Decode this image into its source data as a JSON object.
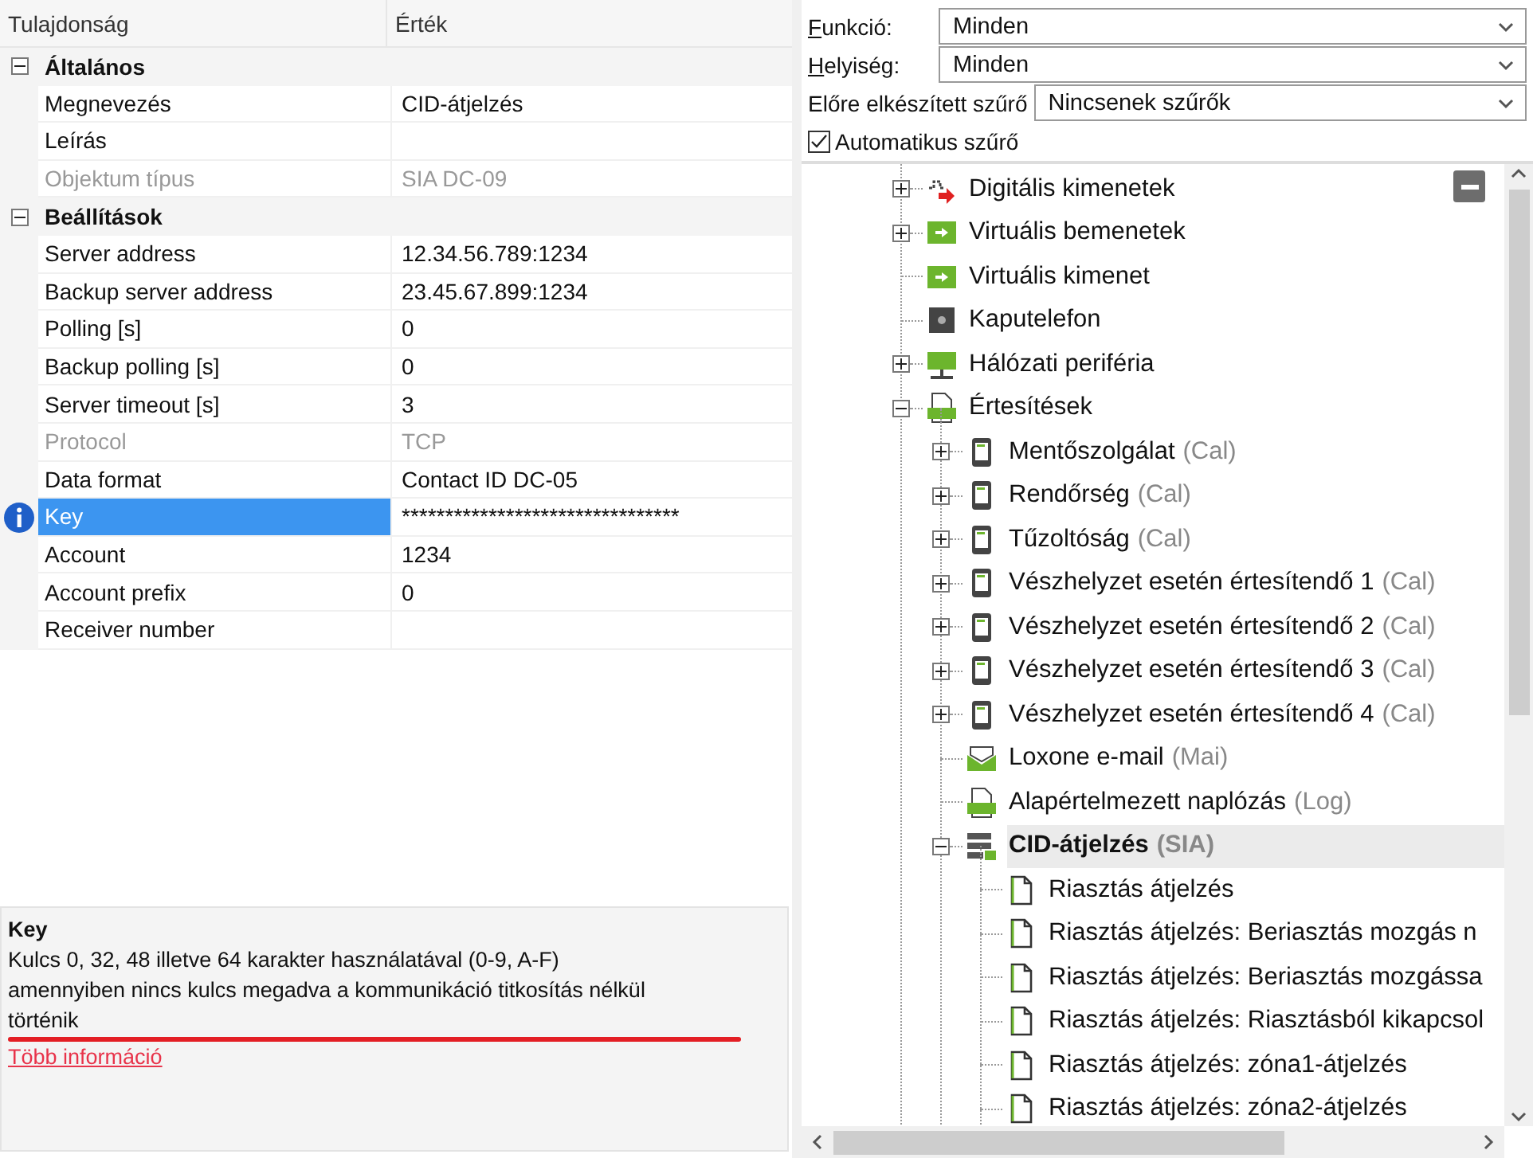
{
  "property_grid": {
    "columns": [
      "Tulajdonság",
      "Érték"
    ],
    "categories": [
      {
        "title": "Általános",
        "expanded": true,
        "rows": [
          {
            "name": "Megnevezés",
            "value": "CID-átjelzés",
            "disabled": false,
            "selected": false
          },
          {
            "name": "Leírás",
            "value": "",
            "disabled": false,
            "selected": false
          },
          {
            "name": "Objektum típus",
            "value": "SIA DC-09",
            "disabled": true,
            "selected": false
          }
        ]
      },
      {
        "title": "Beállítások",
        "expanded": true,
        "rows": [
          {
            "name": "Server address",
            "value": "12.34.56.789:1234",
            "disabled": false,
            "selected": false
          },
          {
            "name": "Backup server address",
            "value": "23.45.67.899:1234",
            "disabled": false,
            "selected": false
          },
          {
            "name": "Polling [s]",
            "value": "0",
            "disabled": false,
            "selected": false
          },
          {
            "name": "Backup polling [s]",
            "value": "0",
            "disabled": false,
            "selected": false
          },
          {
            "name": "Server timeout [s]",
            "value": "3",
            "disabled": false,
            "selected": false
          },
          {
            "name": "Protocol",
            "value": "TCP",
            "disabled": true,
            "selected": false
          },
          {
            "name": "Data format",
            "value": "Contact ID DC-05",
            "disabled": false,
            "selected": false
          },
          {
            "name": "Key",
            "value": "********************************",
            "disabled": false,
            "selected": true,
            "annotated": true
          },
          {
            "name": "Account",
            "value": "1234",
            "disabled": false,
            "selected": false
          },
          {
            "name": "Account prefix",
            "value": "0",
            "disabled": false,
            "selected": false
          },
          {
            "name": "Receiver number",
            "value": "",
            "disabled": false,
            "selected": false
          }
        ]
      }
    ]
  },
  "description": {
    "title": "Key",
    "lines": [
      "Kulcs 0, 32, 48 illetve 64 karakter használatával (0-9, A-F)",
      "amennyiben nincs kulcs megadva a kommunikáció titkosítás nélkül történik"
    ],
    "annotated": true,
    "link": "Több információ"
  },
  "filters": [
    {
      "label": "Funkció:",
      "value": "Minden"
    },
    {
      "label": "Helyiség:",
      "value": "Minden"
    },
    {
      "label": "Előre elkészített szűrő",
      "value": "Nincsenek szűrők"
    }
  ],
  "auto_filter": {
    "label": "Automatikus szűrő",
    "checked": true
  },
  "tree": [
    {
      "name": "Digitális kimenetek",
      "kind": "output",
      "expanded": false,
      "selected": false
    },
    {
      "name": "Virtuális bemenetek",
      "kind": "virtual",
      "expanded": false,
      "selected": false
    },
    {
      "name": "Virtuális kimenet",
      "kind": "virtual",
      "selected": false
    },
    {
      "name": "Kaputelefon",
      "kind": "intercom",
      "selected": false
    },
    {
      "name": "Hálózati periféria",
      "kind": "network",
      "expanded": false,
      "selected": false
    },
    {
      "name": "Értesítések",
      "kind": "log",
      "expanded": true,
      "selected": false,
      "children": [
        {
          "name": "Mentőszolgálat",
          "type": "(Cal)",
          "kind": "phone",
          "expanded": false,
          "selected": false
        },
        {
          "name": "Rendőrség",
          "type": "(Cal)",
          "kind": "phone",
          "expanded": false,
          "selected": false
        },
        {
          "name": "Tűzoltóság",
          "type": "(Cal)",
          "kind": "phone",
          "expanded": false,
          "selected": false
        },
        {
          "name": "Vészhelyzet esetén értesítendő 1",
          "type": "(Cal)",
          "kind": "phone",
          "expanded": false,
          "selected": false
        },
        {
          "name": "Vészhelyzet esetén értesítendő 2",
          "type": "(Cal)",
          "kind": "phone",
          "expanded": false,
          "selected": false
        },
        {
          "name": "Vészhelyzet esetén értesítendő 3",
          "type": "(Cal)",
          "kind": "phone",
          "expanded": false,
          "selected": false
        },
        {
          "name": "Vészhelyzet esetén értesítendő 4",
          "type": "(Cal)",
          "kind": "phone",
          "expanded": false,
          "selected": false
        },
        {
          "name": "Loxone e-mail",
          "type": "(Mai)",
          "kind": "mail",
          "selected": false
        },
        {
          "name": "Alapértelmezett naplózás",
          "type": "(Log)",
          "kind": "log",
          "selected": false
        },
        {
          "name": "CID-átjelzés",
          "type": "(SIA)",
          "kind": "server",
          "expanded": true,
          "selected": true,
          "children": [
            {
              "name": "Riasztás átjelzés",
              "kind": "document",
              "selected": false
            },
            {
              "name": "Riasztás átjelzés: Beriasztás mozgás n",
              "kind": "document",
              "selected": false
            },
            {
              "name": "Riasztás átjelzés: Beriasztás mozgássa",
              "kind": "document",
              "selected": false
            },
            {
              "name": "Riasztás átjelzés: Riasztásból kikapcsol",
              "kind": "document",
              "selected": false
            },
            {
              "name": "Riasztás átjelzés: zóna1-átjelzés",
              "kind": "document",
              "selected": false
            },
            {
              "name": "Riasztás átjelzés: zóna2-átjelzés",
              "kind": "document",
              "selected": false
            }
          ]
        }
      ]
    }
  ]
}
